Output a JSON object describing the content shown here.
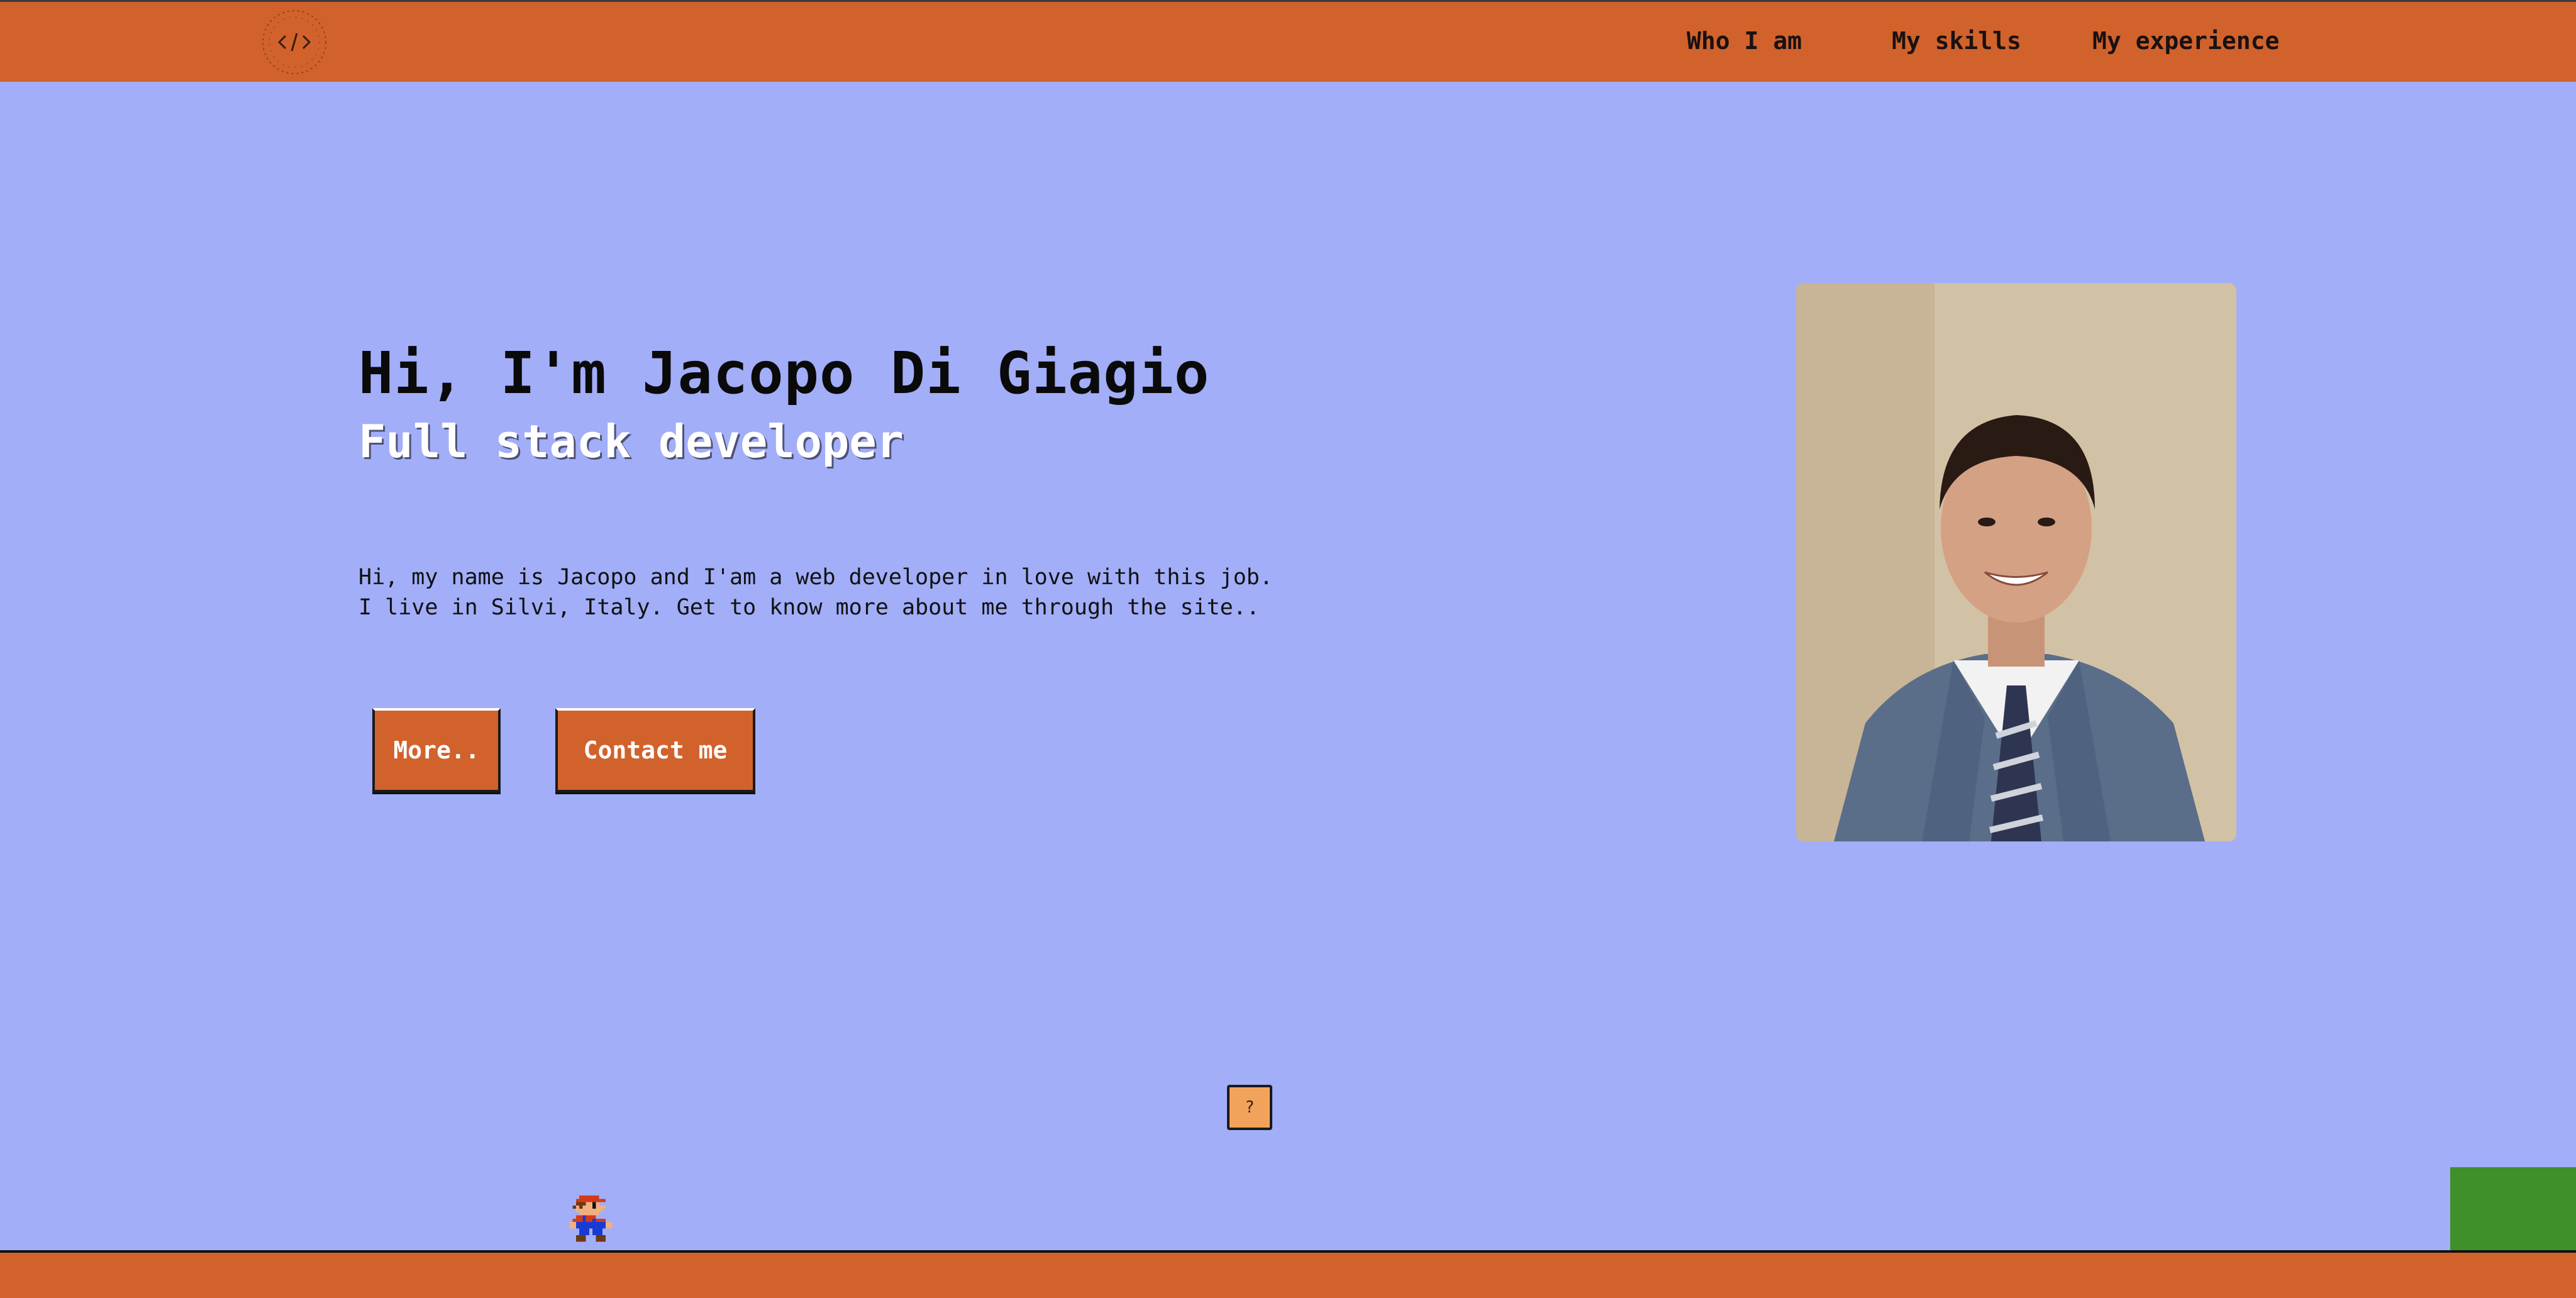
{
  "header": {
    "logo_icon": "code-brackets-logo",
    "nav": [
      {
        "label": "Who I am"
      },
      {
        "label": "My skills"
      },
      {
        "label": "My experience"
      }
    ]
  },
  "hero": {
    "title": "Hi, I'm Jacopo Di Giagio",
    "subtitle": "Full stack developer",
    "description_lines": [
      "Hi, my name is Jacopo and I'am a web developer in love with this job.",
      "I live in Silvi, Italy. Get to know more about me through the site.."
    ],
    "buttons": {
      "more": "More..",
      "contact": "Contact me"
    }
  },
  "game": {
    "question_block_label": "?"
  },
  "colors": {
    "background": "#a2aef8",
    "header": "#d1622c",
    "button": "#d1622c",
    "question_block": "#f2a35b",
    "pipe": "#3f8f2a",
    "ground": "#d1622c"
  }
}
